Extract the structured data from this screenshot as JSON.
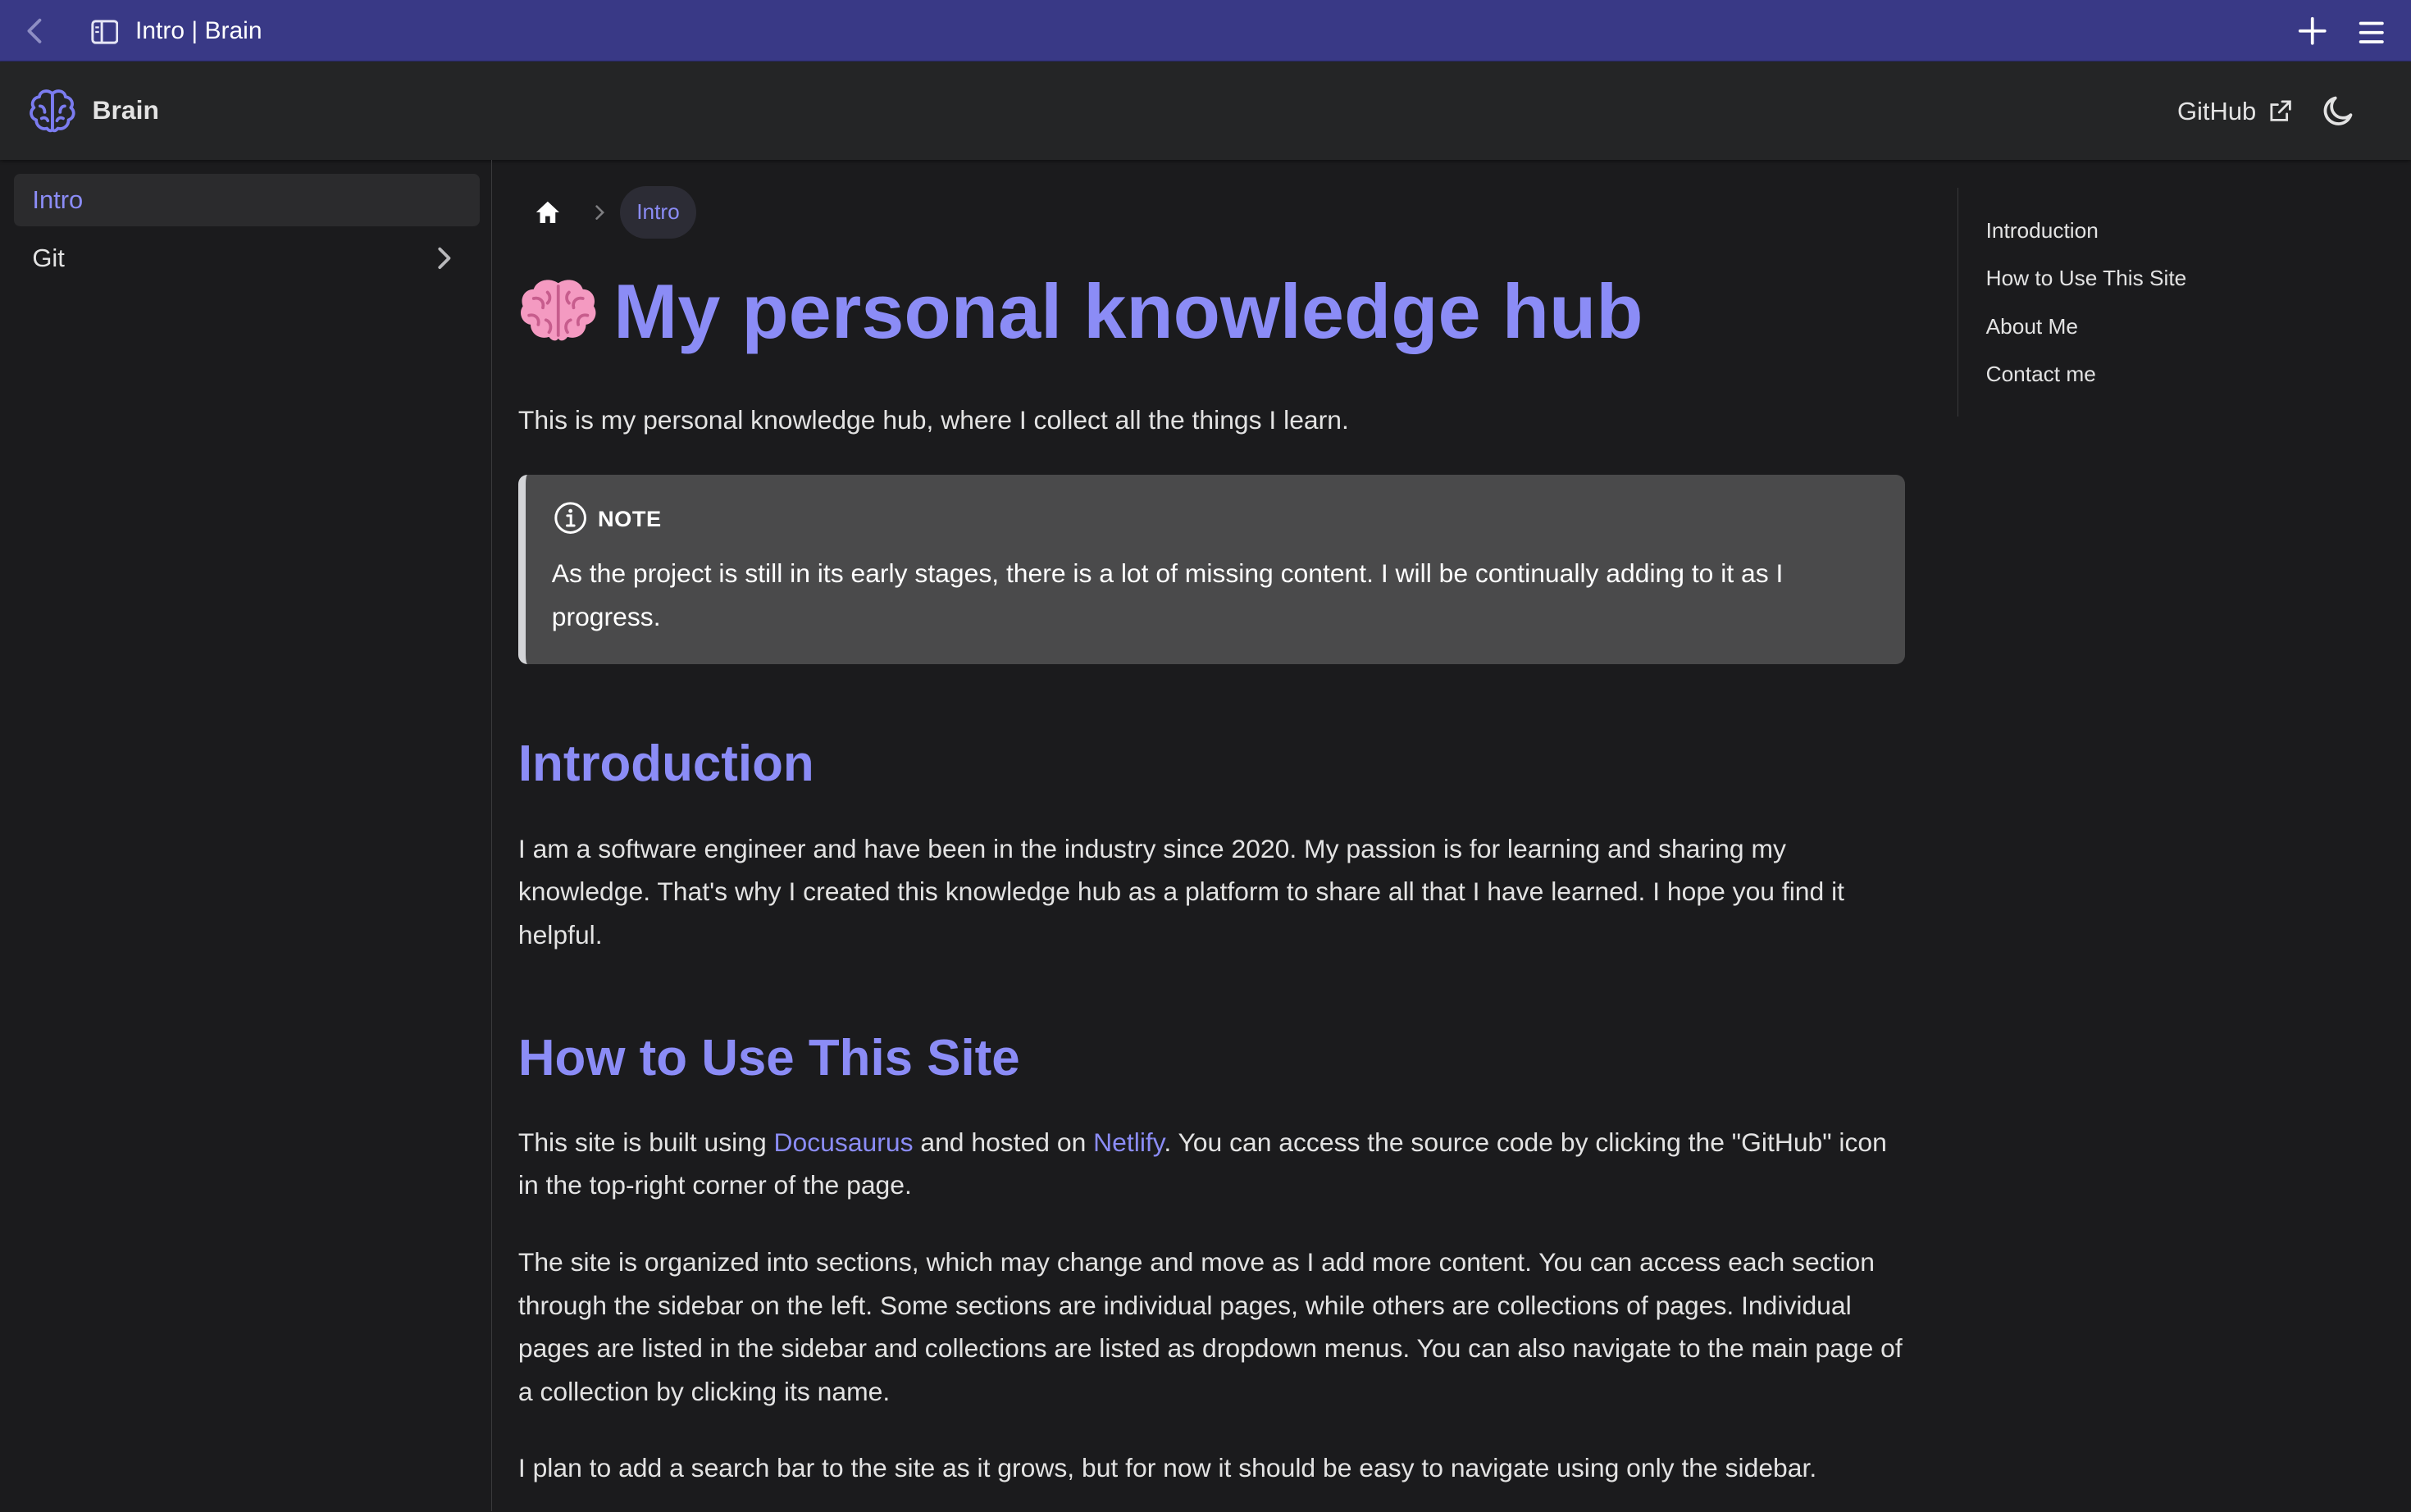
{
  "browser": {
    "title": "Intro | Brain"
  },
  "navbar": {
    "brand": "Brain",
    "github_label": "GitHub"
  },
  "sidebar": {
    "items": [
      {
        "label": "Intro",
        "active": true
      },
      {
        "label": "Git",
        "active": false
      }
    ]
  },
  "breadcrumb": {
    "current": "Intro"
  },
  "page": {
    "title": "My personal knowledge hub",
    "lead": "This is my personal knowledge hub, where I collect all the things I learn.",
    "note": {
      "label": "NOTE",
      "body": "As the project is still in its early stages, there is a lot of missing content. I will be continually adding to it as I progress."
    },
    "sections": [
      {
        "heading": "Introduction",
        "paragraphs": [
          "I am a software engineer and have been in the industry since 2020. My passion is for learning and sharing my knowledge. That's why I created this knowledge hub as a platform to share all that I have learned. I hope you find it helpful."
        ]
      },
      {
        "heading": "How to Use This Site",
        "p1_before": "This site is built using ",
        "p1_link1": "Docusaurus",
        "p1_mid": " and hosted on ",
        "p1_link2": "Netlify",
        "p1_after": ". You can access the source code by clicking the \"GitHub\" icon in the top-right corner of the page.",
        "paragraphs": [
          "The site is organized into sections, which may change and move as I add more content. You can access each section through the sidebar on the left. Some sections are individual pages, while others are collections of pages. Individual pages are listed in the sidebar and collections are listed as dropdown menus. You can also navigate to the main page of a collection by clicking its name.",
          "I plan to add a search bar to the site as it grows, but for now it should be easy to navigate using only the sidebar."
        ]
      }
    ]
  },
  "toc": {
    "items": [
      "Introduction",
      "How to Use This Site",
      "About Me",
      "Contact me"
    ]
  },
  "colors": {
    "accent": "#8b8cf6",
    "background": "#1b1b1d",
    "navbar": "#242526",
    "chrome": "#393986"
  },
  "icons": [
    "chevron-left-icon",
    "sidebar-toggle-icon",
    "plus-icon",
    "hamburger-menu-icon",
    "brain-logo-icon",
    "external-link-icon",
    "moon-icon",
    "chevron-right-icon",
    "home-icon",
    "info-icon",
    "brain-emoji-icon"
  ]
}
